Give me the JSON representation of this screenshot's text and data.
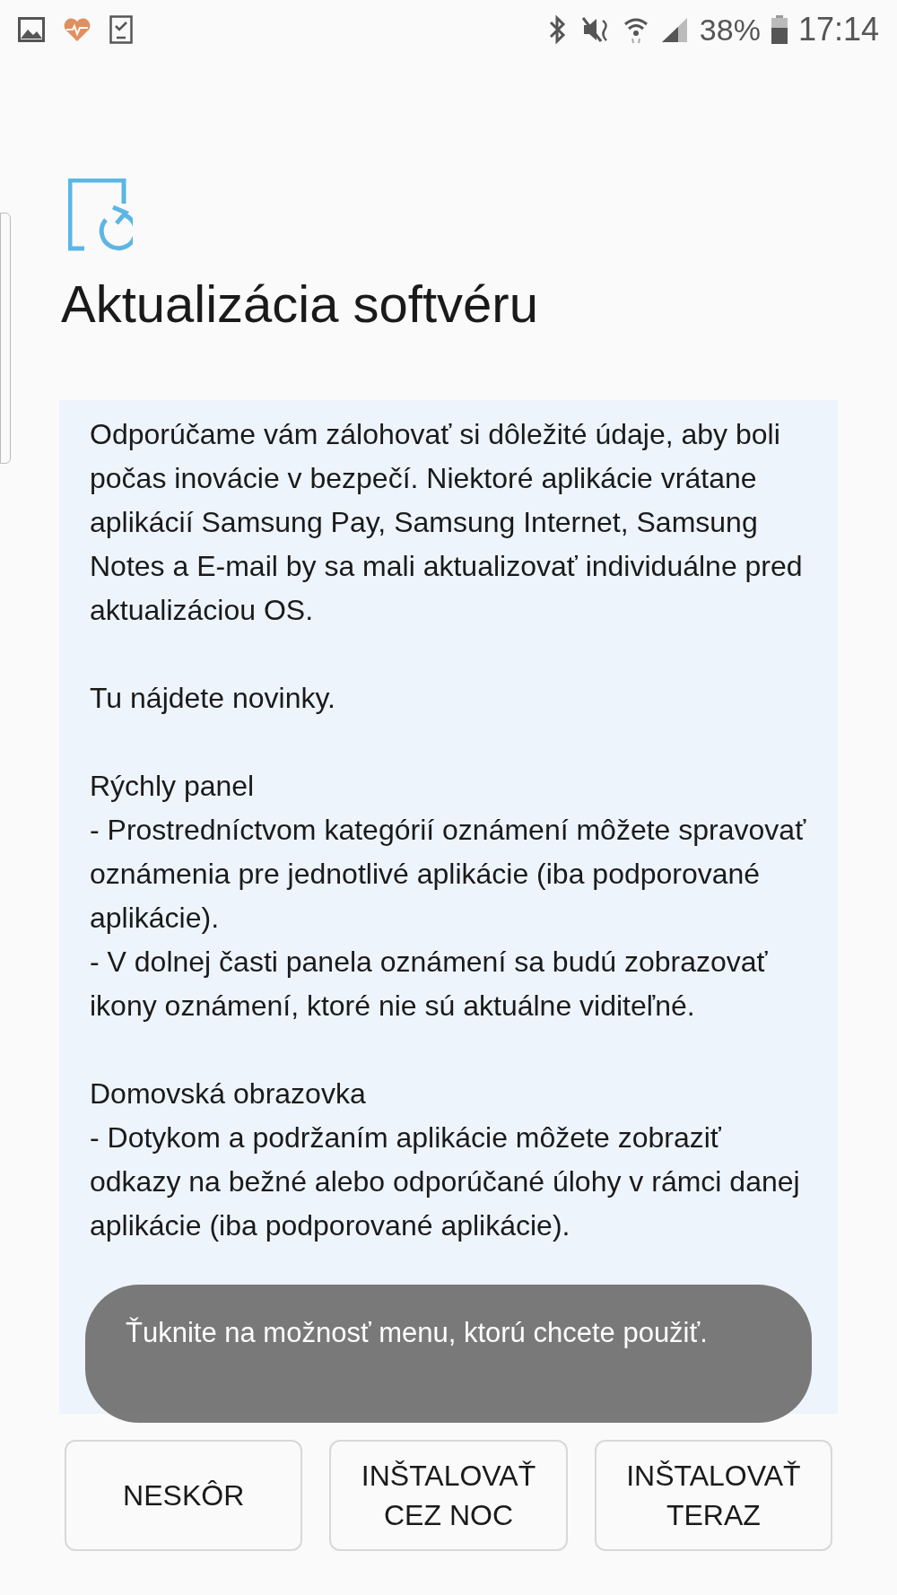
{
  "status_bar": {
    "battery": "38%",
    "time": "17:14"
  },
  "title": "Aktualizácia softvéru",
  "content": [
    {
      "lines": [
        "Odporúčame vám zálohovať si dôležité údaje, aby boli počas inovácie v bezpečí. Niektoré aplikácie vrátane aplikácií Samsung Pay, Samsung Internet, Samsung Notes a E-mail by sa mali aktualizovať individuálne pred aktualizáciou OS."
      ]
    },
    {
      "lines": [
        "Tu nájdete novinky."
      ]
    },
    {
      "lines": [
        "Rýchly panel",
        "- Prostredníctvom kategórií oznámení môžete spravovať oznámenia pre jednotlivé aplikácie (iba podporované aplikácie).",
        "- V dolnej časti panela oznámení sa budú zobrazovať ikony oznámení, ktoré nie sú aktuálne viditeľné."
      ]
    },
    {
      "lines": [
        "Domovská obrazovka",
        "- Dotykom a podržaním aplikácie môžete zobraziť odkazy na bežné alebo odporúčané úlohy v rámci danej aplikácie (iba podporované aplikácie)."
      ]
    }
  ],
  "toast": "Ťuknite na možnosť menu, ktorú chcete použiť.",
  "buttons": [
    "NESKÔR",
    "INŠTALOVAŤ CEZ NOC",
    "INŠTALOVAŤ TERAZ"
  ]
}
